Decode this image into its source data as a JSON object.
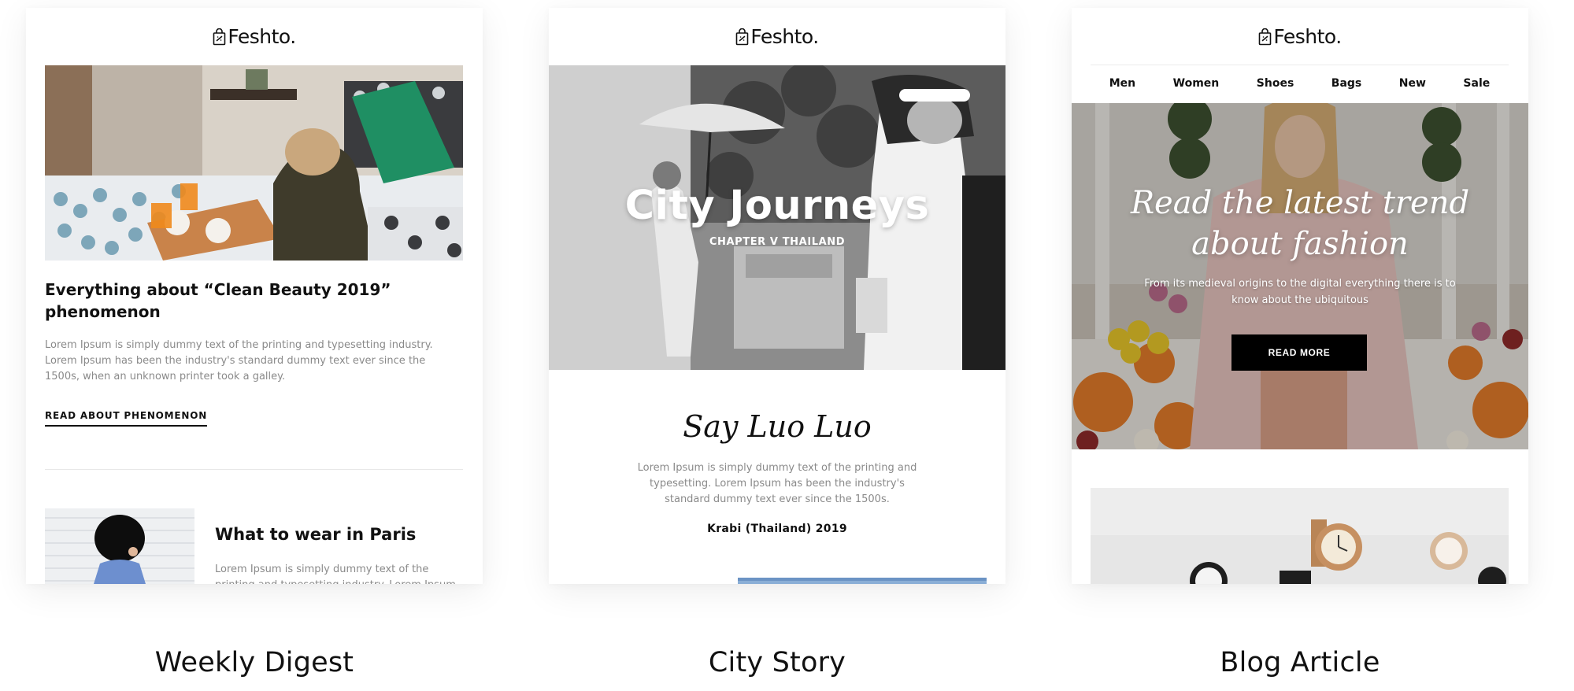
{
  "brand": {
    "logo_icon": "shopping-bag-icon",
    "name": "Feshto."
  },
  "templates": [
    {
      "caption": "Weekly Digest",
      "article_title": "Everything about “Clean Beauty 2019” phenomenon",
      "article_body": "Lorem Ipsum is simply dummy text of the printing and typesetting industry. Lorem Ipsum has been the industry's standard dummy text ever since the 1500s, when an unknown printer took a galley.",
      "link_label": "READ ABOUT PHENOMENON",
      "sub_title": "What to wear in Paris",
      "sub_body": "Lorem Ipsum is simply dummy text of the printing and typesetting industry. Lorem Ipsum"
    },
    {
      "caption": "City Story",
      "hero_title": "City Journeys",
      "hero_subtitle": "CHAPTER V THAILAND",
      "script_heading": "Say Luo Luo",
      "body": "Lorem Ipsum is simply dummy text of the printing and typesetting. Lorem Ipsum has been the industry's standard dummy text ever since the 1500s.",
      "meta": "Krabi (Thailand) 2019"
    },
    {
      "caption": "Blog Article",
      "nav": [
        "Men",
        "Women",
        "Shoes",
        "Bags",
        "New",
        "Sale"
      ],
      "hero_title": "Read the latest trend about fashion",
      "hero_body": "From its medieval origins to the digital everything there is to know about the ubiquitous",
      "cta_label": "READ MORE"
    }
  ],
  "colors": {
    "accent": "#000000",
    "text": "#111111",
    "muted": "#8a8a8a",
    "card_bg": "#ffffff"
  }
}
